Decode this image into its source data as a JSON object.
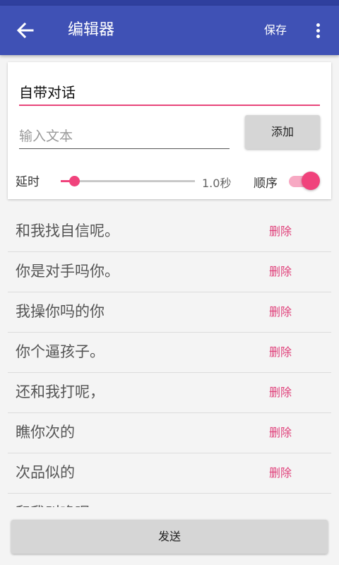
{
  "header": {
    "title": "编辑器",
    "save_label": "保存",
    "back_icon": "arrow-back-icon",
    "more_icon": "more-vert-icon"
  },
  "form": {
    "dialog_name": "自带对话",
    "text_placeholder": "输入文本",
    "text_value": "",
    "add_label": "添加",
    "delay_label": "延时",
    "delay_value": "1.0秒",
    "delay_fraction": 0.1,
    "order_label": "顺序",
    "order_enabled": true
  },
  "list": {
    "items": [
      {
        "text": "和我找自信呢。",
        "delete_label": "删除"
      },
      {
        "text": "你是对手吗你。",
        "delete_label": "删除"
      },
      {
        "text": "我操你吗的你",
        "delete_label": "删除"
      },
      {
        "text": "你个逼孩子。",
        "delete_label": "删除"
      },
      {
        "text": "还和我打呢，",
        "delete_label": "删除"
      },
      {
        "text": "瞧你次的",
        "delete_label": "删除"
      },
      {
        "text": "次品似的",
        "delete_label": "删除"
      },
      {
        "text": "和我叫唤呢",
        "delete_label": "删除"
      }
    ]
  },
  "footer": {
    "send_label": "发送"
  },
  "colors": {
    "primary": "#3f51b5",
    "accent": "#f0437c",
    "background": "#f4f4f4"
  }
}
